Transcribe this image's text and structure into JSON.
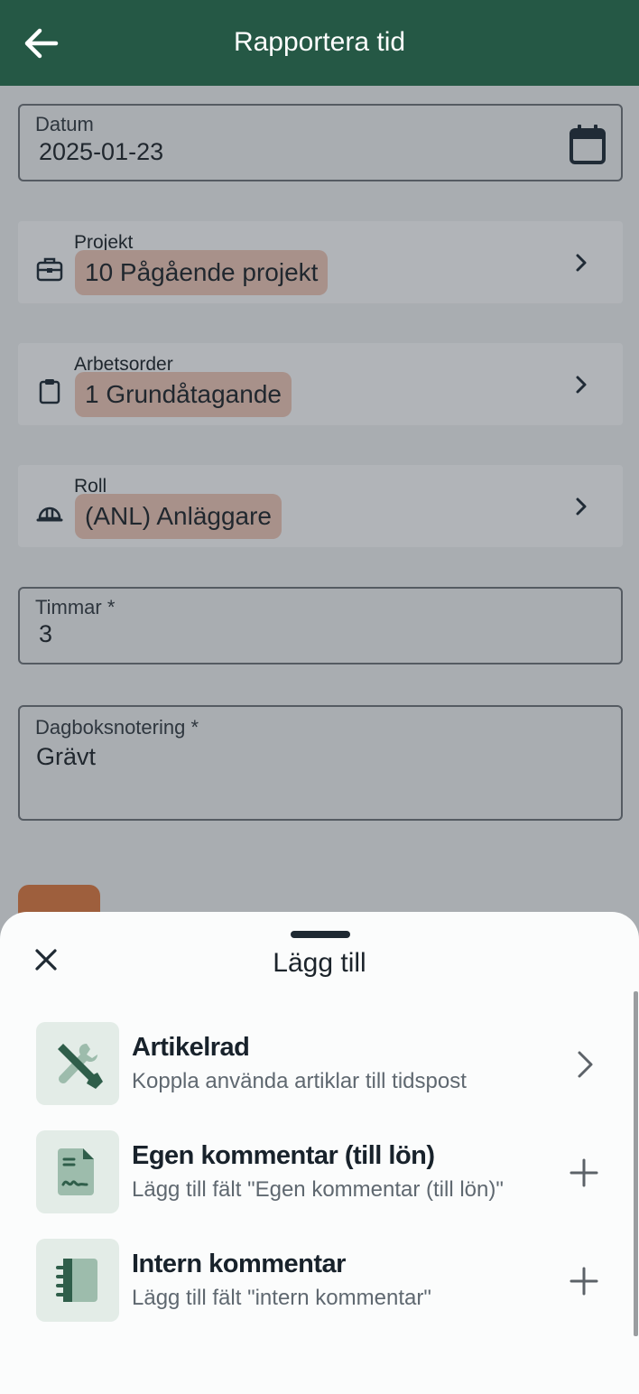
{
  "header": {
    "title": "Rapportera tid"
  },
  "form": {
    "datum": {
      "label": "Datum",
      "value": "2025-01-23"
    },
    "projekt": {
      "label": "Projekt",
      "value": "10 Pågående projekt"
    },
    "arbetsorder": {
      "label": "Arbetsorder",
      "value": "1 Grundåtagande"
    },
    "roll": {
      "label": "Roll",
      "value": "(ANL) Anläggare"
    },
    "timmar": {
      "label": "Timmar *",
      "value": "3"
    },
    "dagbok": {
      "label": "Dagboksnotering *",
      "value": "Grävt"
    }
  },
  "sheet": {
    "title": "Lägg till",
    "items": [
      {
        "title": "Artikelrad",
        "subtitle": "Koppla använda artiklar till tidspost",
        "icon": "tools-icon",
        "action": "chevron-right-icon"
      },
      {
        "title": "Egen kommentar (till lön)",
        "subtitle": "Lägg till fält \"Egen kommentar (till lön)\"",
        "icon": "document-signature-icon",
        "action": "plus-icon"
      },
      {
        "title": "Intern kommentar",
        "subtitle": "Lägg till fält \"intern kommentar\"",
        "icon": "notebook-icon",
        "action": "plus-icon"
      }
    ]
  },
  "colors": {
    "header": "#255845",
    "chip": "#f1c9b8",
    "fab": "#e27a3f",
    "icon_tile": "#e3ece7",
    "icon_green": "#2f5e4a"
  }
}
